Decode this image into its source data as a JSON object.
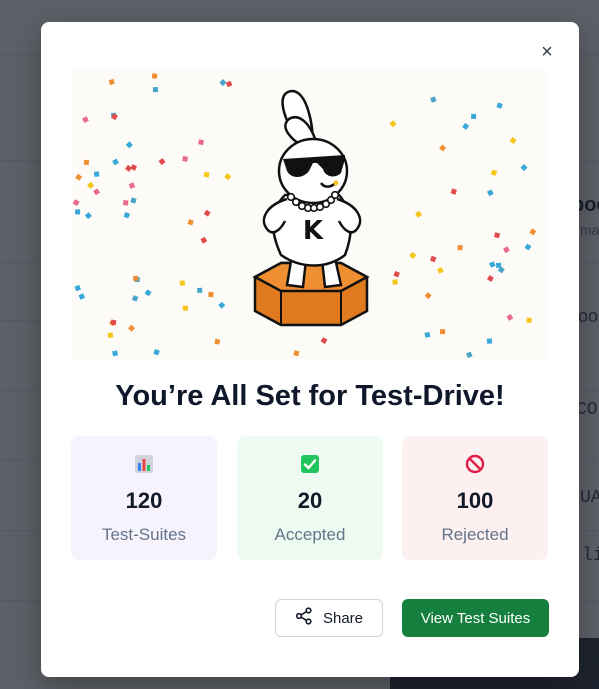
{
  "background": {
    "fragments": [
      "boo",
      "ma",
      "ook",
      "CO",
      "UA",
      "li"
    ]
  },
  "modal": {
    "close_label": "×",
    "title": "You’re All Set for Test-Drive!",
    "mascot_badge": "K",
    "stats": [
      {
        "icon": "bar-chart-icon",
        "value": "120",
        "label": "Test-Suites",
        "bg": "#f7f3fd"
      },
      {
        "icon": "check-box-icon",
        "value": "20",
        "label": "Accepted",
        "bg": "#eefbf2"
      },
      {
        "icon": "prohibited-icon",
        "value": "100",
        "label": "Rejected",
        "bg": "#fdf0f0"
      }
    ],
    "share_label": "Share",
    "primary_label": "View Test Suites",
    "accent": "#15803d"
  }
}
